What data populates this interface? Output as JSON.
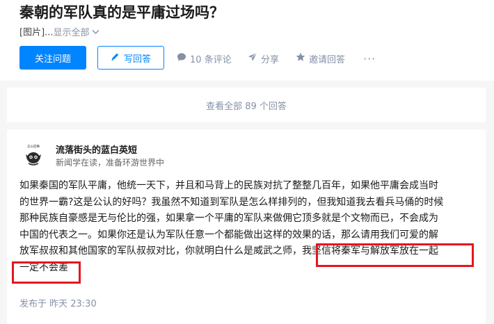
{
  "question": {
    "title": "秦朝的军队真的是平庸过场吗？",
    "excerpt_prefix": "[图片]...",
    "show_all": "显示全部"
  },
  "actions": {
    "follow": "关注问题",
    "write_answer": "写回答",
    "comments": "10 条评论",
    "share": "分享",
    "invite": "邀请回答",
    "more": "···"
  },
  "answers_link": "查看全部 89 个回答",
  "answer": {
    "author_name": "流落街头的蓝白英短",
    "author_bio": "新闻学在读，准备环游世界中",
    "avatar_text": "怎么回事",
    "lines": [
      "如果秦国的军队平庸，他统一天下，并且和马背上的民族对抗了整整几百年，如果他平庸会成当时",
      "的世界一霸?这是公认的好吗？我虽然不知道到军队是怎么样排列的，但我知道我去看兵马俑的时候",
      "那种民族自豪感是无与伦比的强，如果拿一个平庸的军队来做佣它顶多就是个文物而已，不会成为",
      "中国的代表之一。如果你还是认为军队任意一个都能做出这样的效果的话，那么请用我们可爱的解"
    ],
    "line5_plain": "放军叔叔和其他国家的军队叔叔对比，你就明白什么是威武之师，",
    "line5_highlight": "我坚信将秦军与解放军放在一起",
    "line6_highlight": "一定不会差",
    "posted": "发布于 昨天 23:30"
  },
  "colors": {
    "accent": "#0084ff",
    "highlight_box": "#e5161c",
    "muted": "#8590a6",
    "background": "#f6f6f6"
  },
  "icons": [
    "chevron-down-icon",
    "pencil-icon",
    "comment-icon",
    "share-icon",
    "star-icon",
    "more-icon"
  ]
}
